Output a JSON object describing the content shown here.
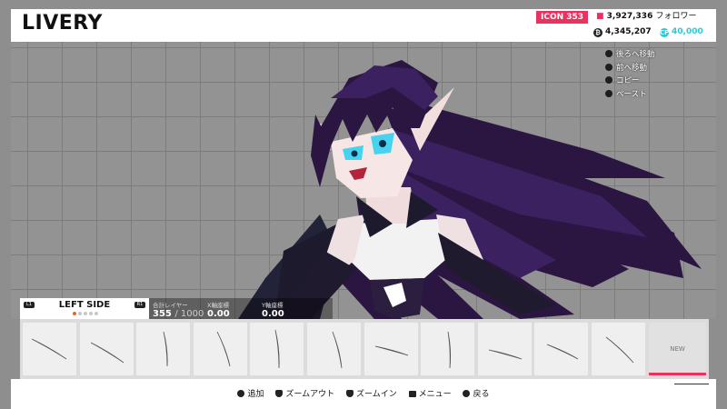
{
  "header": {
    "title": "LIVERY",
    "icon_badge": "ICON 353",
    "followers_value": "3,927,336",
    "followers_label": "フォロワー",
    "coins_value": "4,345,207",
    "cp_value": "40,000",
    "cp_label": "CP"
  },
  "shortcuts": [
    {
      "label": "後ろへ移動",
      "icon": "l1-button-icon"
    },
    {
      "label": "前へ移動",
      "icon": "r1-button-icon"
    },
    {
      "label": "コピー",
      "icon": "l2-button-icon"
    },
    {
      "label": "ペースト",
      "icon": "r2-button-icon"
    }
  ],
  "layer_panel": {
    "title": "LEFT SIDE",
    "left_hint": "L1",
    "right_hint": "R1",
    "pages_total": 5,
    "page_active": 1
  },
  "info": {
    "layers_label": "合計レイヤー",
    "layers_value": "355",
    "layers_max": "/ 1000",
    "x_label": "X軸座標",
    "x_value": "0.00",
    "y_label": "Y軸座標",
    "y_value": "0.00"
  },
  "strip": {
    "new_label": "NEW",
    "slot_count": 11
  },
  "footer": {
    "hints": [
      {
        "label": "追加",
        "icon": "circle-button-icon"
      },
      {
        "label": "ズームアウト",
        "icon": "l2-zoom-icon"
      },
      {
        "label": "ズームイン",
        "icon": "r2-zoom-icon"
      },
      {
        "label": "メニュー",
        "icon": "options-button-icon"
      },
      {
        "label": "戻る",
        "icon": "cross-button-icon"
      }
    ]
  },
  "colors": {
    "accent_pink": "#e8325f",
    "cp_cyan": "#2bc9d4",
    "hair_purple": "#2a1640"
  }
}
